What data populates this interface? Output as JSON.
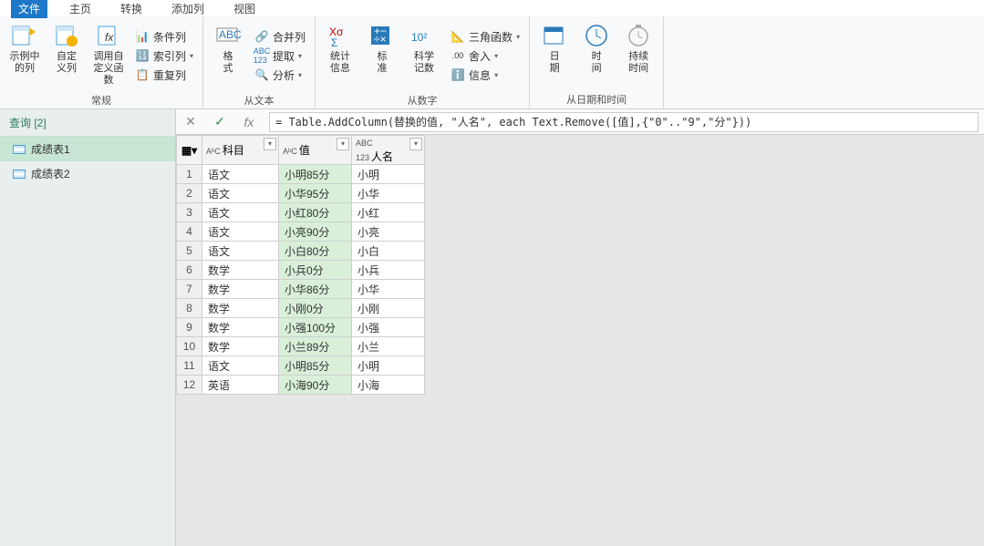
{
  "tabs": {
    "file": "文件",
    "home": "主页",
    "transform": "转换",
    "addcol": "添加列",
    "view": "视图"
  },
  "ribbon": {
    "general": {
      "label": "常规",
      "examplecol": "示例中\n的列",
      "customcol": "自定\n义列",
      "invokefn": "调用自\n定义函数",
      "condcol": "条件列",
      "indexcol": "索引列",
      "dupcol": "重复列"
    },
    "fromtext": {
      "label": "从文本",
      "format": "格\n式",
      "merge": "合并列",
      "extract": "提取",
      "parse": "分析"
    },
    "fromnum": {
      "label": "从数字",
      "stats": "统计\n信息",
      "standard": "标\n准",
      "scientific": "科学\n记数",
      "trig": "三角函数",
      "round": "舍入",
      "info": "信息"
    },
    "fromdate": {
      "label": "从日期和时间",
      "date": "日\n期",
      "time": "时\n间",
      "duration": "持续\n时间"
    }
  },
  "sidebar": {
    "header": "查询 [2]",
    "items": [
      "成绩表1",
      "成绩表2"
    ]
  },
  "formula": "= Table.AddColumn(替换的值, \"人名\", each Text.Remove([值],{\"0\"..\"9\",\"分\"}))",
  "columns": {
    "subject": "科目",
    "value": "值",
    "name": "人名"
  },
  "rows": [
    {
      "subject": "语文",
      "value": "小明85分",
      "name": "小明"
    },
    {
      "subject": "语文",
      "value": "小华95分",
      "name": "小华"
    },
    {
      "subject": "语文",
      "value": "小红80分",
      "name": "小红"
    },
    {
      "subject": "语文",
      "value": "小亮90分",
      "name": "小亮"
    },
    {
      "subject": "语文",
      "value": "小白80分",
      "name": "小白"
    },
    {
      "subject": "数学",
      "value": "小兵0分",
      "name": "小兵"
    },
    {
      "subject": "数学",
      "value": "小华86分",
      "name": "小华"
    },
    {
      "subject": "数学",
      "value": "小刚0分",
      "name": "小刚"
    },
    {
      "subject": "数学",
      "value": "小强100分",
      "name": "小强"
    },
    {
      "subject": "数学",
      "value": "小兰89分",
      "name": "小兰"
    },
    {
      "subject": "语文",
      "value": "小明85分",
      "name": "小明"
    },
    {
      "subject": "英语",
      "value": "小海90分",
      "name": "小海"
    }
  ]
}
